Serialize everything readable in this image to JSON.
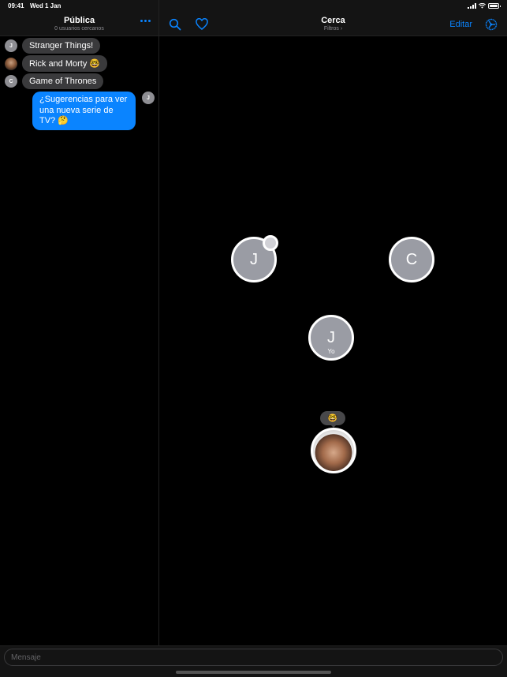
{
  "status_bar": {
    "time": "09:41",
    "date": "Wed 1 Jan"
  },
  "left_panel": {
    "title": "Pública",
    "subtitle": "0 usuarios cercanos",
    "more_icon": "ellipsis-icon",
    "messages": [
      {
        "sender_initial": "J",
        "avatar": "initial",
        "text": "Stranger Things!",
        "direction": "in"
      },
      {
        "sender_initial": "",
        "avatar": "photo",
        "text": "Rick and Morty 🤓",
        "direction": "in"
      },
      {
        "sender_initial": "C",
        "avatar": "initial",
        "text": "Game of Thrones",
        "direction": "in"
      },
      {
        "sender_initial": "J",
        "avatar": "initial",
        "text": "¿Sugerencias para ver una nueva serie de TV? 🤔",
        "direction": "out"
      }
    ]
  },
  "right_panel": {
    "title": "Cerca",
    "subtitle": "Filtros ›",
    "search_icon": "search-icon",
    "favorite_icon": "heart-icon",
    "edit_label": "Editar",
    "settings_icon": "steering-wheel-icon",
    "peers": [
      {
        "initial": "J",
        "label": "",
        "has_badge": true
      },
      {
        "initial": "C",
        "label": "",
        "has_badge": false
      },
      {
        "initial": "J",
        "label": "Yo",
        "has_badge": false
      },
      {
        "initial": "",
        "label": "",
        "photo": true,
        "emoji": "🤓"
      }
    ]
  },
  "composer": {
    "placeholder": "Mensaje",
    "value": ""
  },
  "colors": {
    "accent": "#0a84ff",
    "bubble_in": "#3a3a3c",
    "avatar_gray": "#9a9ca4",
    "background": "#000000",
    "bar": "#141414"
  }
}
